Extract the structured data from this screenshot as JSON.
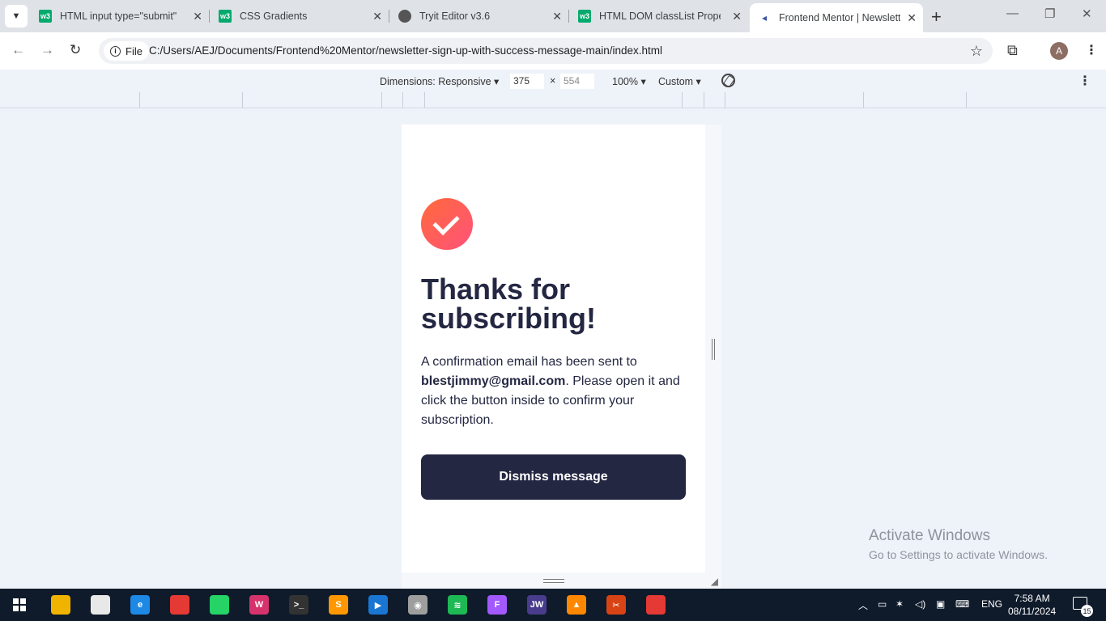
{
  "browser": {
    "tabs": [
      {
        "title": "HTML input type=\"submit\"",
        "icon": "w3schools-icon",
        "fav": "w3"
      },
      {
        "title": "CSS Gradients",
        "icon": "w3schools-icon",
        "fav": "w3"
      },
      {
        "title": "Tryit Editor v3.6",
        "icon": "globe-icon",
        "fav": ""
      },
      {
        "title": "HTML DOM classList Propert",
        "icon": "w3schools-icon",
        "fav": "w3"
      },
      {
        "title": "Frontend Mentor | Newslette",
        "icon": "frontend-mentor-icon",
        "fav": "◄"
      }
    ],
    "address": {
      "scheme_label": "File",
      "url": "C:/Users/AEJ/Documents/Frontend%20Mentor/newsletter-sign-up-with-success-message-main/index.html"
    },
    "profile_initial": "A"
  },
  "device_toolbar": {
    "dimensions_label": "Dimensions: Responsive",
    "width": "375",
    "times": "×",
    "height": "554",
    "zoom": "100%",
    "throttle": "Custom"
  },
  "page": {
    "title": "Thanks for subscribing!",
    "message_before": "A confirmation email has been sent to ",
    "email": "blestjimmy@gmail.com",
    "message_after": ". Please open it and click the button inside to confirm your subscription.",
    "dismiss_label": "Dismiss message",
    "colors": {
      "dark_navy": "#242742",
      "tomato": "#ff6155",
      "gradient_start": "#ff6a3a",
      "gradient_end": "#ff527b"
    }
  },
  "watermark": {
    "line1": "Activate Windows",
    "line2": "Go to Settings to activate Windows."
  },
  "taskbar": {
    "apps": [
      {
        "name": "file-explorer-icon",
        "color": "#f0b400",
        "glyph": ""
      },
      {
        "name": "store-icon",
        "color": "#e8e8e8",
        "glyph": ""
      },
      {
        "name": "edge-icon",
        "color": "#1e88e5",
        "glyph": "e"
      },
      {
        "name": "chrome-icon",
        "color": "#e53935",
        "glyph": ""
      },
      {
        "name": "whatsapp-icon",
        "color": "#25d366",
        "glyph": ""
      },
      {
        "name": "wps-icon",
        "color": "#d6336c",
        "glyph": "W"
      },
      {
        "name": "terminal-icon",
        "color": "#333333",
        "glyph": ">_"
      },
      {
        "name": "sublime-icon",
        "color": "#ff9800",
        "glyph": "S"
      },
      {
        "name": "media-player-icon",
        "color": "#1976d2",
        "glyph": "▶"
      },
      {
        "name": "media-icon",
        "color": "#9e9e9e",
        "glyph": "◉"
      },
      {
        "name": "spotify-icon",
        "color": "#1db954",
        "glyph": "≋"
      },
      {
        "name": "figma-icon",
        "color": "#a259ff",
        "glyph": "F"
      },
      {
        "name": "jw-icon",
        "color": "#4a3c8c",
        "glyph": "JW"
      },
      {
        "name": "vlc-icon",
        "color": "#ff8800",
        "glyph": "▲"
      },
      {
        "name": "snipping-tool-icon",
        "color": "#d84315",
        "glyph": "✂"
      },
      {
        "name": "chrome-icon-2",
        "color": "#e53935",
        "glyph": ""
      }
    ],
    "language": "ENG",
    "time": "7:58 AM",
    "date": "08/11/2024",
    "notifications": "15"
  }
}
